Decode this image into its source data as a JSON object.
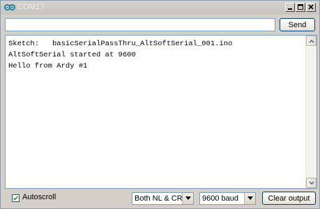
{
  "window": {
    "title": "COM17",
    "icon": "arduino-infinity-icon"
  },
  "send": {
    "input_value": "",
    "button_label": "Send"
  },
  "output": {
    "lines": [
      "Sketch:   basicSerialPassThru_AltSoftSerial_001.ino",
      "AltSoftSerial started at 9600",
      "Hello from Ardy #1"
    ]
  },
  "footer": {
    "autoscroll_label": "Autoscroll",
    "autoscroll_checked": true,
    "line_ending_selected": "Both NL & CR",
    "baud_selected": "9600 baud",
    "clear_label": "Clear output"
  },
  "colors": {
    "accent": "#1f86a6",
    "border": "#7f9db9"
  }
}
